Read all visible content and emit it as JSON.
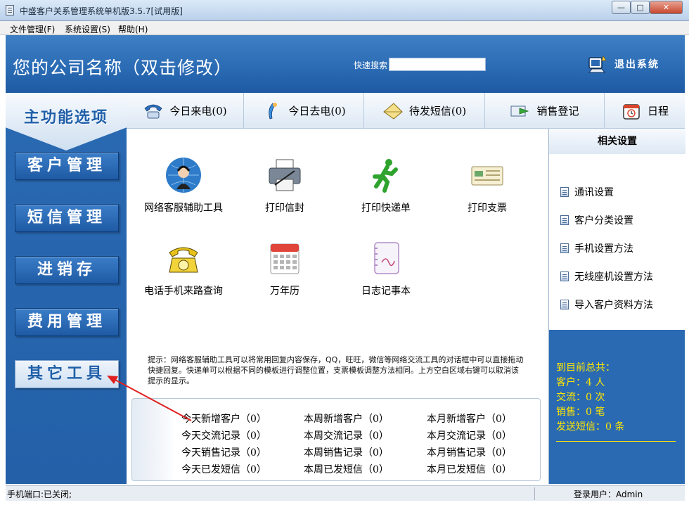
{
  "window": {
    "title": "中盛客户关系管理系统单机版3.5.7[试用版]",
    "min_label": "—",
    "max_label": "□",
    "close_label": "✕"
  },
  "menu": {
    "file": "文件管理(F)",
    "settings": "系统设置(S)",
    "help": "帮助(H)"
  },
  "header": {
    "company": "您的公司名称（双击修改）",
    "search_label": "快速搜索",
    "search_value": "",
    "exit_label": "退出系统"
  },
  "leftnav": {
    "main_label": "主功能选项",
    "items": [
      {
        "label": "客户管理"
      },
      {
        "label": "短信管理"
      },
      {
        "label": "进销存"
      },
      {
        "label": "费用管理"
      },
      {
        "label": "其它工具"
      }
    ]
  },
  "tabs": [
    {
      "label": "今日来电(0)",
      "icon": "phone-incoming-icon"
    },
    {
      "label": "今日去电(0)",
      "icon": "phone-outgoing-icon"
    },
    {
      "label": "待发短信(0)",
      "icon": "sms-pending-icon"
    },
    {
      "label": "销售登记",
      "icon": "sales-register-icon"
    },
    {
      "label": "日程",
      "icon": "schedule-icon"
    }
  ],
  "tools": [
    {
      "label": "网络客服辅助工具",
      "icon": "customer-service-icon"
    },
    {
      "label": "打印信封",
      "icon": "printer-envelope-icon"
    },
    {
      "label": "打印快递单",
      "icon": "running-man-icon"
    },
    {
      "label": "打印支票",
      "icon": "check-icon"
    },
    {
      "label": "电话手机来路查询",
      "icon": "telephone-icon"
    },
    {
      "label": "万年历",
      "icon": "calendar-icon"
    },
    {
      "label": "日志记事本",
      "icon": "notebook-icon"
    }
  ],
  "tip": "提示：网络客服辅助工具可以将常用回复内容保存，QQ，旺旺，微信等网络交流工具的对话框中可以直接拖动快捷回复。快递单可以根据不同的模板进行调整位置，支票模板调整方法相同。上方空白区域右键可以取消该提示的显示。",
  "stats": {
    "today": [
      "今天新增客户（0）",
      "今天交流记录（0）",
      "今天销售记录（0）",
      "今天已发短信（0）"
    ],
    "week": [
      "本周新增客户（0）",
      "本周交流记录（0）",
      "本周销售记录（0）",
      "本周已发短信（0）"
    ],
    "month": [
      "本月新增客户（0）",
      "本月交流记录（0）",
      "本月销售记录（0）",
      "本月已发短信（0）"
    ]
  },
  "rightpanel": {
    "title": "相关设置",
    "items": [
      "通讯设置",
      "客户分类设置",
      "手机设置方法",
      "无线座机设置方法",
      "导入客户资料方法"
    ],
    "summary": [
      "到目前总共：",
      "客户：4 人",
      "交流：0 次",
      "销售：0 笔",
      "发送短信：0 条"
    ]
  },
  "statusbar": {
    "port": "手机端口:已关闭;",
    "user": "登录用户：Admin"
  },
  "colors": {
    "accent_blue": "#2a6ab3",
    "summary_yellow": "#ffe600",
    "arrow_red": "#e02020"
  }
}
